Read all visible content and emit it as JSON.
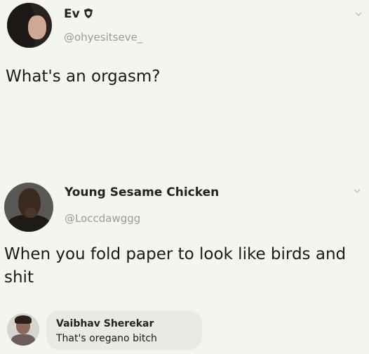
{
  "tweet1": {
    "author_name": "Ev",
    "verified_icon": "shield-icon",
    "handle": "@ohyesitseve_",
    "text": "What's an orgasm?"
  },
  "tweet2": {
    "author_name": "Young Sesame Chicken",
    "handle": "@Loccdawggg",
    "text": "When you fold paper to look like birds and shit"
  },
  "comment": {
    "author_name": "Vaibhav Sherekar",
    "text": "That's oregano bitch"
  },
  "colors": {
    "background": "#f5f5f0",
    "handle": "#9a9a9a",
    "bubble": "#e9e9e6"
  }
}
